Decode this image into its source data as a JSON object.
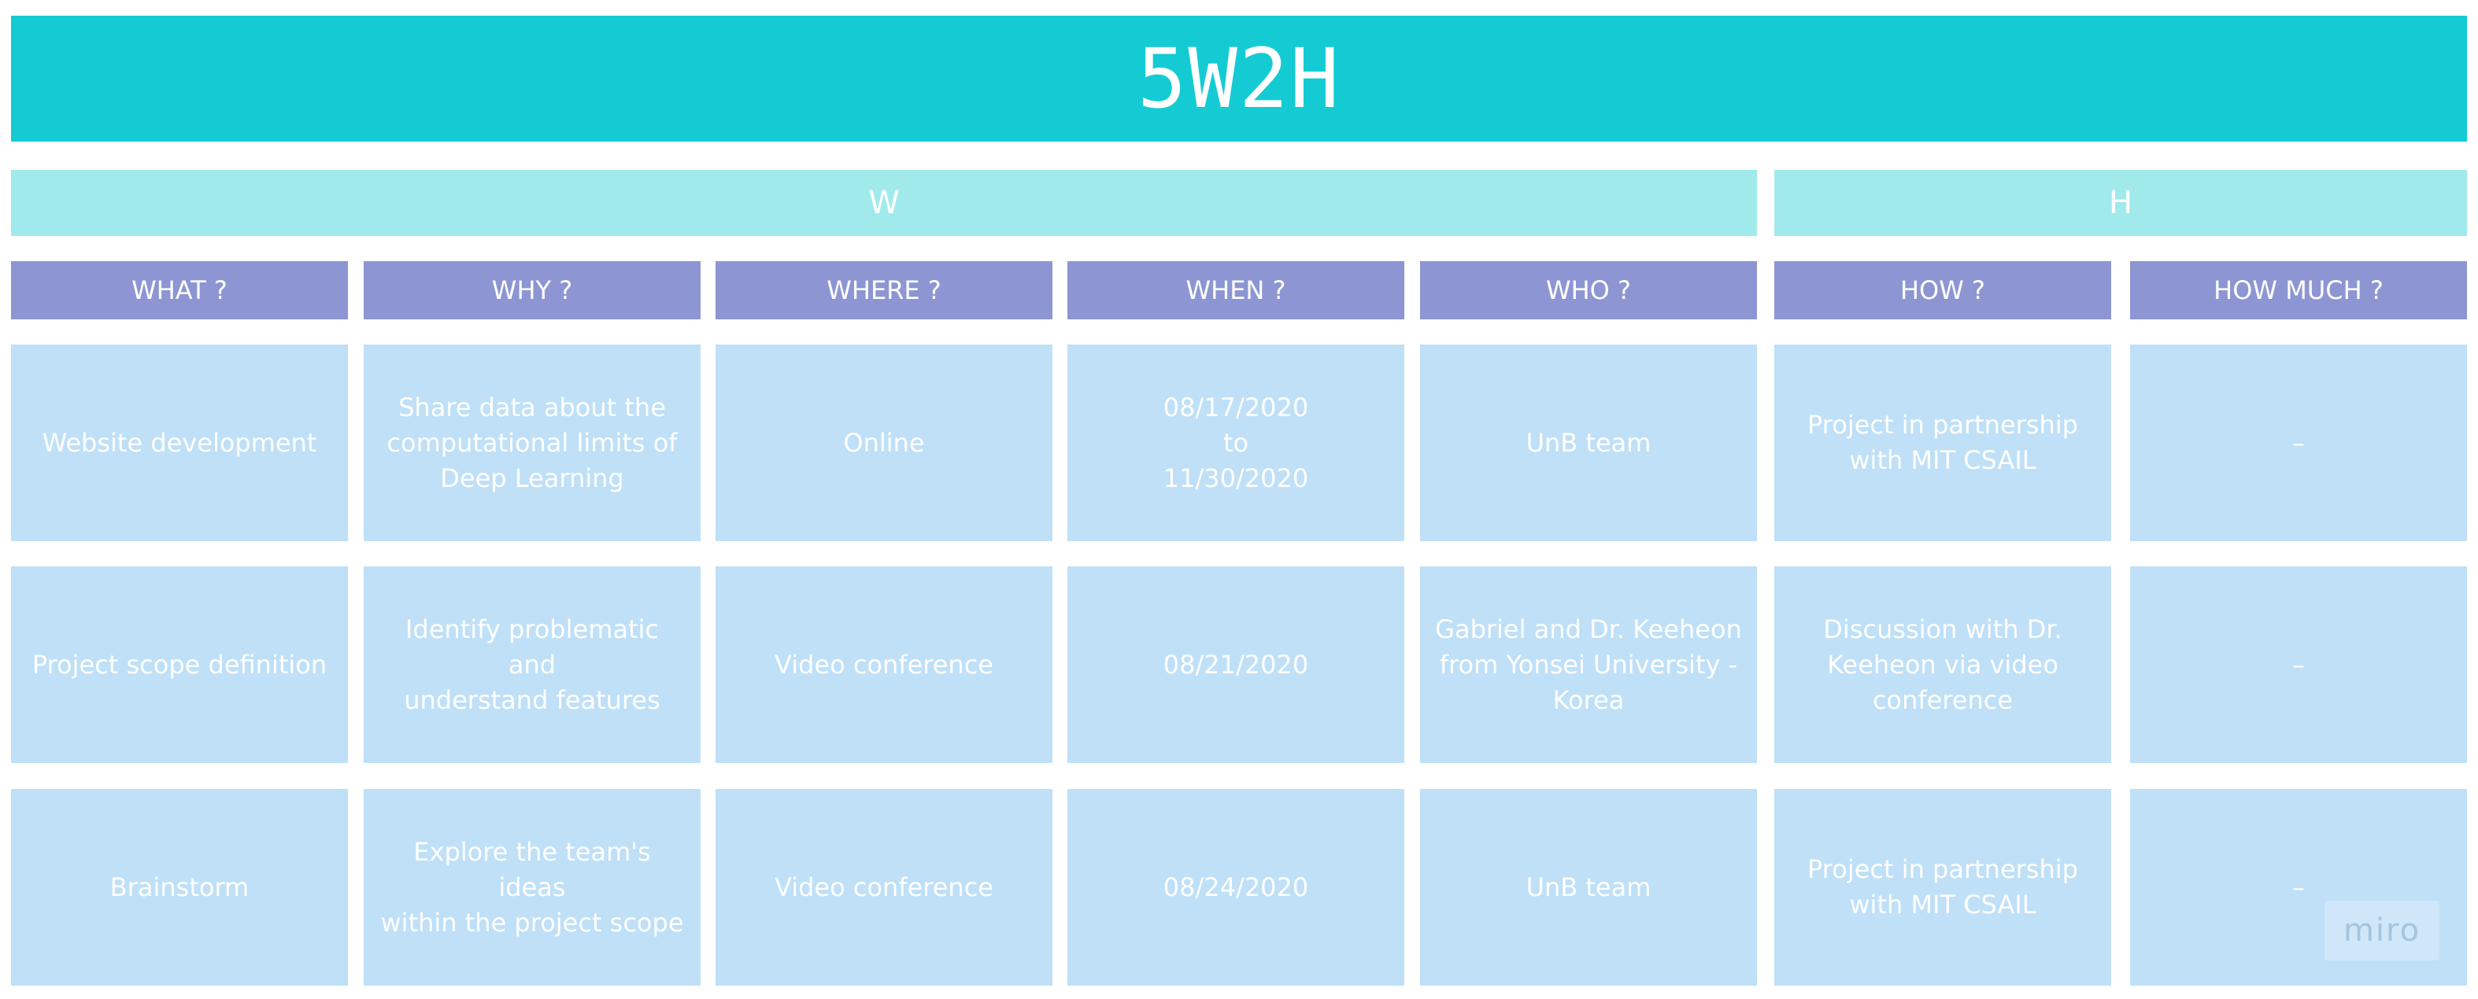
{
  "title": "5W2H",
  "groups": {
    "w": "W",
    "h": "H"
  },
  "columns": [
    "WHAT ?",
    "WHY ?",
    "WHERE ?",
    "WHEN ?",
    "WHO ?",
    "HOW ?",
    "HOW MUCH ?"
  ],
  "rows": [
    [
      "Website development",
      "Share data about the\ncomputational limits of\nDeep Learning",
      "Online",
      "08/17/2020\nto\n11/30/2020",
      "UnB team",
      "Project in partnership\nwith MIT CSAIL",
      "–"
    ],
    [
      "Project scope definition",
      "Identify problematic and\nunderstand features",
      "Video conference",
      "08/21/2020",
      "Gabriel and Dr. Keeheon\nfrom Yonsei University -\nKorea",
      "Discussion with Dr.\nKeeheon via video\nconference",
      "–"
    ],
    [
      "Brainstorm",
      "Explore the team's ideas\nwithin the project scope",
      "Video conference",
      "08/24/2020",
      "UnB team",
      "Project in partnership\nwith MIT CSAIL",
      "–"
    ]
  ],
  "watermark": "miro",
  "colors": {
    "banner": "#14cbd3",
    "group_header": "#a0eaec",
    "column_header": "#8d96d3",
    "cell": "#bfe0f7",
    "text": "#ffffff"
  }
}
